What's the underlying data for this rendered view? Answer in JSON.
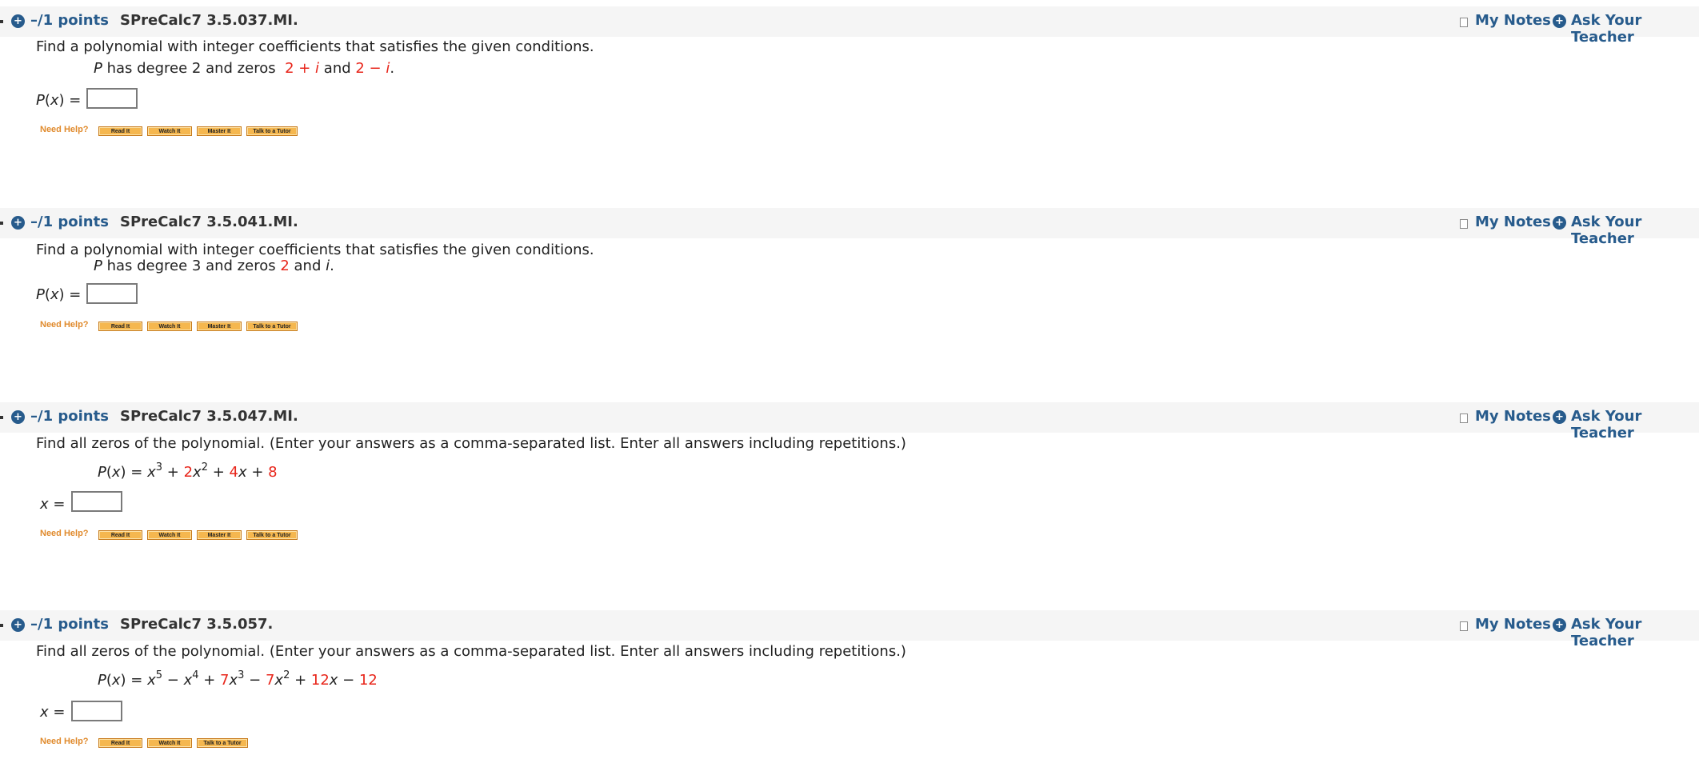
{
  "header_links": {
    "my_notes": "My Notes",
    "ask_teacher": "Ask Your Teacher"
  },
  "need_help_label": "Need Help?",
  "help_buttons": {
    "read": "Read It",
    "watch": "Watch It",
    "master": "Master It",
    "tutor": "Talk to a Tutor"
  },
  "colors": {
    "link": "#275b8c",
    "highlight": "#e8261b",
    "need_help": "#e08a2c",
    "button": "#f5b74f"
  },
  "questions": [
    {
      "points": "–/1 points",
      "id": "SPreCalc7 3.5.037.MI.",
      "prompt": "Find a polynomial with integer coefficients that satisfies the given conditions.",
      "condition": {
        "p": "P",
        "text1": " has degree 2 and zeros ",
        "z1": "2 + ",
        "z1i": "i",
        "and": " and ",
        "z2": "2 − ",
        "z2i": "i",
        "end": "."
      },
      "answer_label": "P(x) =",
      "answer_value": ""
    },
    {
      "points": "–/1 points",
      "id": "SPreCalc7 3.5.041.MI.",
      "prompt": "Find a polynomial with integer coefficients that satisfies the given conditions.",
      "condition": {
        "p": "P",
        "text1": " has degree 3 and zeros ",
        "z1": "2",
        "and": " and ",
        "z2i": "i",
        "end": "."
      },
      "answer_label": "P(x) =",
      "answer_value": ""
    },
    {
      "points": "–/1 points",
      "id": "SPreCalc7 3.5.047.MI.",
      "prompt": "Find all zeros of the polynomial. (Enter your answers as a comma-separated list. Enter all answers including repetitions.)",
      "equation": {
        "lhs": "P(x) = ",
        "t1": "x",
        "e1": "3",
        "op1": " + ",
        "c2": "2",
        "t2": "x",
        "e2": "2",
        "op2": " + ",
        "c3": "4",
        "t3": "x",
        "op3": " + ",
        "c4": "8"
      },
      "answer_label": "x =",
      "answer_value": ""
    },
    {
      "points": "–/1 points",
      "id": "SPreCalc7 3.5.057.",
      "prompt": "Find all zeros of the polynomial. (Enter your answers as a comma-separated list. Enter all answers including repetitions.)",
      "equation": {
        "lhs": "P(x) = ",
        "t1": "x",
        "e1": "5",
        "op1": " − ",
        "t2": "x",
        "e2": "4",
        "op2": " + ",
        "c3": "7",
        "t3": "x",
        "e3": "3",
        "op3": " − ",
        "c4": "7",
        "t4": "x",
        "e4": "2",
        "op4": " + ",
        "c5": "12",
        "t5": "x",
        "op5": " − ",
        "c6": "12"
      },
      "answer_label": "x =",
      "answer_value": ""
    }
  ]
}
